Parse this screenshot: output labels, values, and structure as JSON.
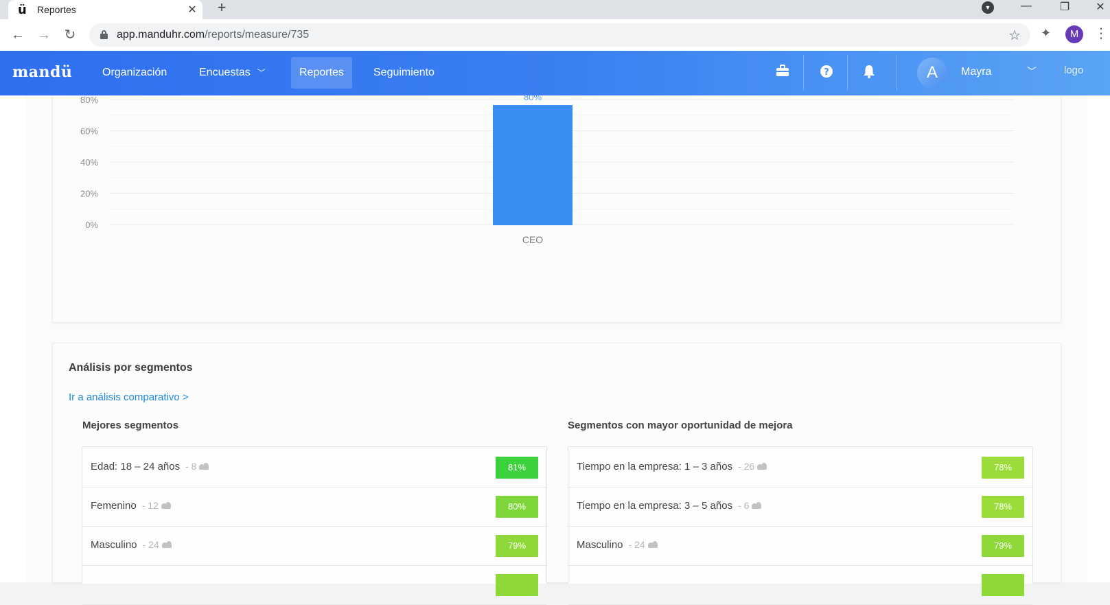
{
  "browser": {
    "tab_title": "Reportes",
    "tab_favicon": "ü",
    "url_host": "app.manduhr.com",
    "url_path": "/reports/measure/735",
    "profile_initial": "M"
  },
  "navbar": {
    "brand": "mandü",
    "items": [
      {
        "label": "Organización"
      },
      {
        "label": "Encuestas"
      },
      {
        "label": "Reportes"
      },
      {
        "label": "Seguimiento"
      }
    ],
    "user_initial": "A",
    "user_name": "Mayra",
    "logo_alt": "logo"
  },
  "chart_data": {
    "type": "bar",
    "categories": [
      "CEO"
    ],
    "values": [
      80
    ],
    "data_labels": [
      "80%"
    ],
    "y_ticks": [
      "0%",
      "20%",
      "40%",
      "60%",
      "80%"
    ],
    "ylim": [
      0,
      80
    ],
    "bar_color": "#3a8ef0",
    "label_color": "#5a9ef5",
    "grid": true
  },
  "segments": {
    "title": "Análisis por segmentos",
    "link": "Ir a análisis comparativo >",
    "best": {
      "title": "Mejores segmentos",
      "rows": [
        {
          "label": "Edad: 18 – 24 años",
          "count": "- 8",
          "value": "81%",
          "color": "#3ed13e"
        },
        {
          "label": "Femenino",
          "count": "- 12",
          "value": "80%",
          "color": "#7fd63a"
        },
        {
          "label": "Masculino",
          "count": "- 24",
          "value": "79%",
          "color": "#8fd83a"
        },
        {
          "label": "",
          "count": "",
          "value": "",
          "color": "#8fd83a"
        }
      ]
    },
    "worst": {
      "title": "Segmentos con mayor oportunidad de mejora",
      "rows": [
        {
          "label": "Tiempo en la empresa: 1 – 3 años",
          "count": "- 26",
          "value": "78%",
          "color": "#9bdb3a"
        },
        {
          "label": "Tiempo en la empresa: 3 – 5 años",
          "count": "- 6",
          "value": "78%",
          "color": "#9bdb3a"
        },
        {
          "label": "Masculino",
          "count": "- 24",
          "value": "79%",
          "color": "#8fd83a"
        },
        {
          "label": "",
          "count": "",
          "value": "",
          "color": "#8fd83a"
        }
      ]
    }
  }
}
